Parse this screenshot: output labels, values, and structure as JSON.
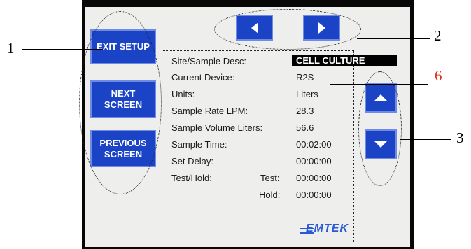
{
  "buttons": {
    "exit_setup": "EXIT SETUP",
    "next_screen": "NEXT\nSCREEN",
    "previous_screen": "PREVIOUS\nSCREEN"
  },
  "fields": [
    {
      "label": "Site/Sample Desc:",
      "value": "CELL CULTURE"
    },
    {
      "label": "Current Device:",
      "value": "R2S"
    },
    {
      "label": "Units:",
      "value": "Liters"
    },
    {
      "label": "Sample Rate LPM:",
      "value": "28.3"
    },
    {
      "label": "Sample Volume Liters:",
      "value": "56.6"
    },
    {
      "label": "Sample Time:",
      "value": "00:02:00"
    },
    {
      "label": "Set Delay:",
      "value": "00:00:00"
    }
  ],
  "test_hold": {
    "label": "Test/Hold:",
    "test_label": "Test:",
    "test_value": "00:00:00",
    "hold_label": "Hold:",
    "hold_value": "00:00:00"
  },
  "logo": "EMTEK",
  "callouts": {
    "one": "1",
    "two": "2",
    "three": "3",
    "six": "6"
  },
  "colors": {
    "button_blue": "#1a43c6",
    "callout_six": "#e0321f",
    "logo_blue": "#2a5bd6"
  },
  "icons": {
    "left": "left-arrow-icon",
    "right": "right-arrow-icon",
    "up": "up-arrow-icon",
    "down": "down-arrow-icon"
  }
}
